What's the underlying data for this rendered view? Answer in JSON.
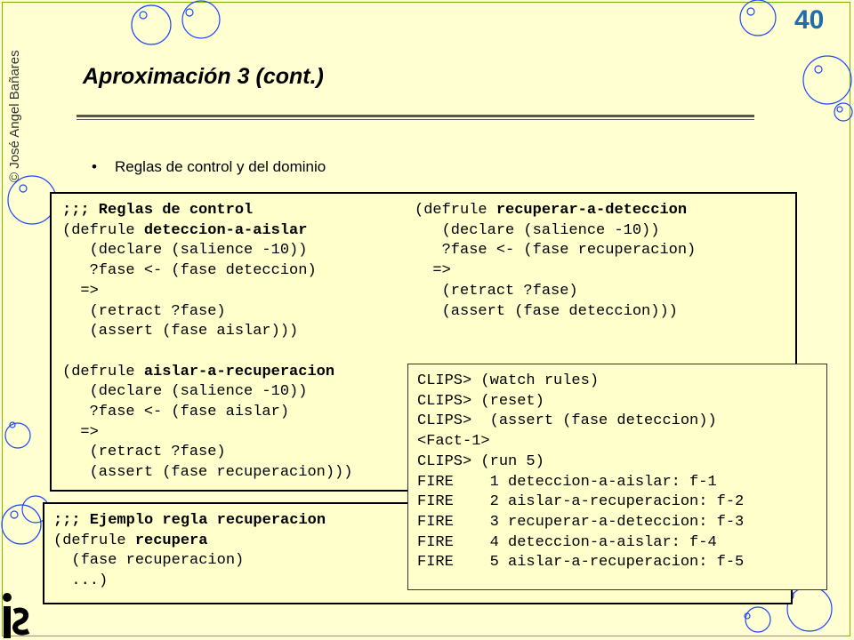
{
  "slide": {
    "page_number": "40",
    "copyright": "© José Angel Bañares",
    "title": "Aproximación 3 (cont.)",
    "bullet": "Reglas de control y del dominio"
  },
  "box1": {
    "left": [
      {
        "text": ";;; Reglas de control",
        "bold": true
      },
      {
        "pre": "(defrule ",
        "bold": "deteccion-a-aislar"
      },
      {
        "text": "   (declare (salience -10))"
      },
      {
        "text": "   ?fase <- (fase deteccion)"
      },
      {
        "text": "  =>"
      },
      {
        "text": "   (retract ?fase)"
      },
      {
        "text": "   (assert (fase aislar)))"
      },
      {
        "text": ""
      },
      {
        "pre": "(defrule ",
        "bold": "aislar-a-recuperacion"
      },
      {
        "text": "   (declare (salience -10))"
      },
      {
        "text": "   ?fase <- (fase aislar)"
      },
      {
        "text": "  =>"
      },
      {
        "text": "   (retract ?fase)"
      },
      {
        "text": "   (assert (fase recuperacion)))"
      }
    ],
    "right": [
      {
        "pre": "(defrule ",
        "bold": "recuperar-a-deteccion"
      },
      {
        "text": "   (declare (salience -10))"
      },
      {
        "text": "   ?fase <- (fase recuperacion)"
      },
      {
        "text": "  =>"
      },
      {
        "text": "   (retract ?fase)"
      },
      {
        "text": "   (assert (fase deteccion)))"
      }
    ]
  },
  "box2": {
    "lines": [
      {
        "text": ";;; Ejemplo regla recuperacion",
        "bold": true
      },
      {
        "pre": "(defrule ",
        "bold": "recupera"
      },
      {
        "text": "  (fase recuperacion)"
      },
      {
        "text": "  ...)"
      }
    ]
  },
  "box3": {
    "lines": [
      "CLIPS> (watch rules)",
      "CLIPS> (reset)",
      "CLIPS>  (assert (fase deteccion))",
      "<Fact-1>",
      "CLIPS> (run 5)",
      "FIRE    1 deteccion-a-aislar: f-1",
      "FIRE    2 aislar-a-recuperacion: f-2",
      "FIRE    3 recuperar-a-deteccion: f-3",
      "FIRE    4 deteccion-a-aislar: f-4",
      "FIRE    5 aislar-a-recuperacion: f-5"
    ]
  },
  "colors": {
    "background": "#ffffd2",
    "bubble": "#1e46ff",
    "page_number": "#1f6db0",
    "frame": "#7ab800"
  },
  "icons": [
    "bubble-decoration",
    "logo-icon"
  ]
}
